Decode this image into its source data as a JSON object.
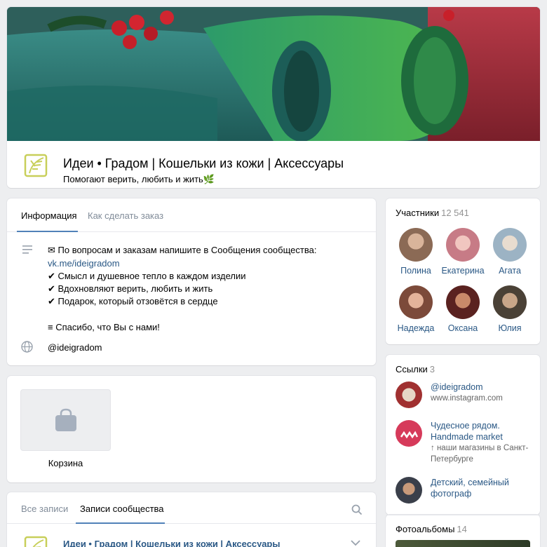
{
  "group": {
    "title": "Идеи • Градом | Кошельки из кожи | Аксессуары",
    "status": "Помогают верить, любить и жить🌿"
  },
  "info_tabs": [
    {
      "label": "Информация",
      "active": true
    },
    {
      "label": "Как сделать заказ",
      "active": false
    }
  ],
  "info": {
    "line1": "✉ По вопросам и заказам напишите в Сообщения сообщества:",
    "link": "vk.me/ideigradom",
    "bullets": [
      "✔ Смысл и душевное тепло в каждом изделии",
      "✔ Вдохновляют верить, любить и жить",
      "✔ Подарок, который отзовётся в сердце"
    ],
    "thanks": "≡ Спасибо, что Вы с нами!",
    "site": "@ideigradom"
  },
  "cart": {
    "label": "Корзина"
  },
  "wall": {
    "tabs": [
      {
        "label": "Все записи",
        "active": false
      },
      {
        "label": "Записи сообщества",
        "active": true
      }
    ],
    "post_author": "Идеи • Градом | Кошельки из кожи | Аксессуары"
  },
  "members": {
    "title": "Участники",
    "count": "12 541",
    "items": [
      {
        "name": "Полина",
        "color": "#8b6a55"
      },
      {
        "name": "Екатерина",
        "color": "#c77b86"
      },
      {
        "name": "Агата",
        "color": "#9cb3c4"
      },
      {
        "name": "Надежда",
        "color": "#7c4a3a"
      },
      {
        "name": "Оксана",
        "color": "#5a2220"
      },
      {
        "name": "Юлия",
        "color": "#4a4136"
      }
    ]
  },
  "links": {
    "title": "Ссылки",
    "count": "3",
    "items": [
      {
        "title": "@ideigradom",
        "desc": "www.instagram.com",
        "color": "#a03030"
      },
      {
        "title": "Чудесное рядом. Handmade market",
        "desc": "↑ наши магазины в Санкт-Петербурге",
        "color": "#d63a5a"
      },
      {
        "title": "Детский, семейный фотограф",
        "desc": "",
        "color": "#3a3f4a"
      }
    ]
  },
  "albums": {
    "title": "Фотоальбомы",
    "count": "14"
  },
  "colors": {
    "accent": "#5181b8",
    "link": "#2a5885",
    "logo": "#c8cf5a"
  }
}
